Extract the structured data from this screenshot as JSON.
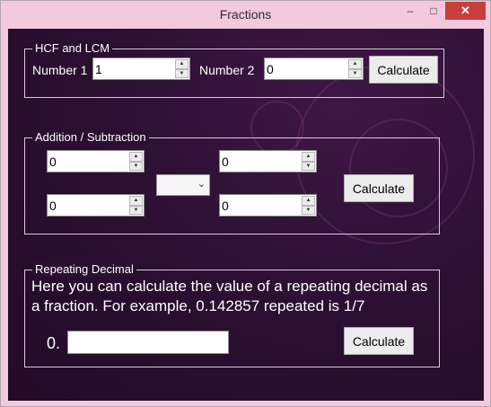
{
  "window": {
    "title": "Fractions",
    "minimize_icon": "minimize-icon",
    "maximize_icon": "maximize-icon",
    "close_icon": "close-icon",
    "minimize_glyph": "–",
    "maximize_glyph": "□",
    "close_glyph": "✕"
  },
  "hcf_lcm": {
    "group_title": "HCF and LCM",
    "number1_label": "Number 1",
    "number1_value": "1",
    "number2_label": "Number 2",
    "number2_value": "0",
    "calculate_label": "Calculate"
  },
  "addition": {
    "group_title": "Addition / Subtraction",
    "top_left_value": "0",
    "bottom_left_value": "0",
    "top_right_value": "0",
    "bottom_right_value": "0",
    "operator_value": "",
    "calculate_label": "Calculate"
  },
  "repeating": {
    "group_title": "Repeating Decimal",
    "description": "Here you can calculate the value of a repeating decimal as a fraction. For example, 0.142857 repeated is 1/7",
    "prefix": "0.",
    "input_value": "",
    "calculate_label": "Calculate"
  },
  "spin_glyphs": {
    "up": "▲",
    "down": "▼"
  },
  "combo_glyph": "⌄",
  "colors": {
    "window_frame": "#f3c9dd",
    "client_background": "#2a0f30",
    "close_button": "#c7403b"
  }
}
